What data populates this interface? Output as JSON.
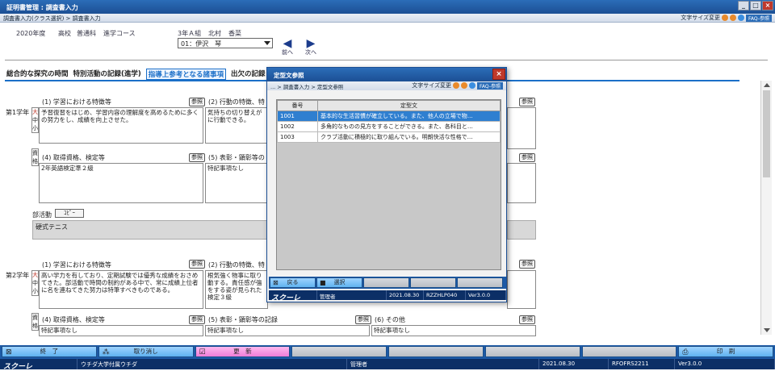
{
  "window": {
    "title": "証明書管理 : 調査書入力"
  },
  "breadcrumb": "調査書入力(クラス選択) > 調査書入力",
  "font_size_label": "文字サイズ変更",
  "faq_label": "FAQ-参照",
  "header": {
    "year": "2020年度",
    "school": "高校",
    "course1": "普通科",
    "course2": "進学コース",
    "class": "3年Ａ組",
    "teacher": "北村",
    "teacher2": "香菜",
    "student": "01：伊沢　琴",
    "prev": "前へ",
    "next": "次へ"
  },
  "tabs": [
    "総合的な探究の時間",
    "特別活動の記録(進学)",
    "指導上参考となる諸事項",
    "出欠の記録"
  ],
  "ref_label": "参照",
  "copy_label": "ｺﾋﾟｰ",
  "year1": {
    "label": "第1学年",
    "s1": "(1) 学習における特徴等",
    "t1": "予習復習をはじめ、学習内容の理解度を高めるために多くの努力をし、成績を向上させた。",
    "s2": "(2) 行動の特徴、特",
    "t2": "気持ちの切り替えが\nに行動できる。",
    "s4": "(4) 取得資格、検定等",
    "t4": "2年英語検定準２級",
    "s5": "(5) 表彰・顕彰等の",
    "t5": "特記事項なし",
    "club_label": "部活動",
    "club": "硬式テニス",
    "badge1": [
      "大",
      "中",
      "小"
    ],
    "badge2": [
      "資",
      "格"
    ]
  },
  "year2": {
    "label": "第2学年",
    "s1": "(1) 学習における特徴等",
    "t1": "高い学力を有しており、定期試験では優秀な成績をおさめてきた。部活動で時間の制約がある中で、常に成績上位者に名を連ねてきた努力は特筆すべきものである。",
    "s2": "(2) 行動の特徴、特",
    "t2": "根気強く物事に取り\n動する。責任感が強\nをする姿が見られた\n検定３級",
    "s4": "(4) 取得資格、検定等",
    "t4": "特記事項なし",
    "s5": "(5) 表彰・顕彰等の記録",
    "t5": "特記事項なし",
    "s6": "(6) その他",
    "t6": "特記事項なし",
    "badge1": [
      "大",
      "中",
      "小"
    ],
    "badge2": [
      "資",
      "格"
    ]
  },
  "footer": {
    "buttons": [
      "終　了",
      "",
      "取り消し",
      "",
      "更　新",
      "",
      "",
      "",
      "",
      "",
      "",
      "印　刷"
    ]
  },
  "status": {
    "logo": "スクーレ",
    "school": "ウチダ大学付属ウチダ",
    "user": "管理者",
    "date": "2021.08.30",
    "code": "RFOFRS2211",
    "ver": "Ver3.0.0"
  },
  "modal": {
    "title": "定型文参照",
    "breadcrumb": "... > 調査書入力 > 定型文参照",
    "font_size_label": "文字サイズ変更",
    "faq_label": "FAQ-参照",
    "columns": [
      "番号",
      "定型文"
    ],
    "rows": [
      {
        "no": "1001",
        "text": "基本的な生活習慣が確立している。また、他人の立場で物…"
      },
      {
        "no": "1002",
        "text": "多角的なものの見方をすることができる。また、各科目と…"
      },
      {
        "no": "1003",
        "text": "クラブ活動に積極的に取り組んでいる。明朗快活な性格で…"
      }
    ],
    "buttons": [
      "戻る",
      "選択",
      "",
      "",
      ""
    ],
    "status": {
      "logo": "スクーレ",
      "user": "管理者",
      "date": "2021.08.30",
      "code": "RZZHLP040",
      "ver": "Ver3.0.0"
    }
  },
  "colors": {
    "accent": "#1b6fc8",
    "title_bar": "#1c4f94",
    "footer": "#1d5aa7",
    "selected_row": "#2f7fd0"
  }
}
